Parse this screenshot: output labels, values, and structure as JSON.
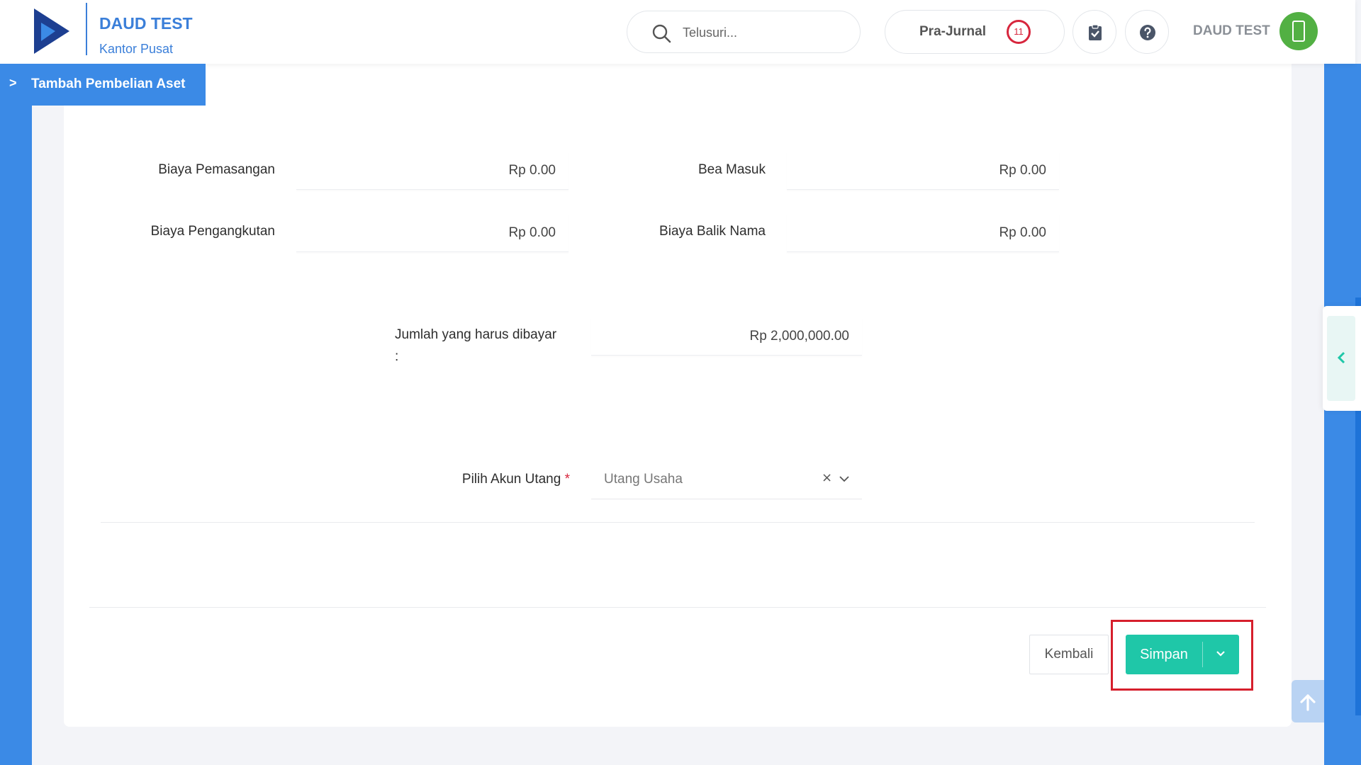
{
  "header": {
    "brand_name": "DAUD TEST",
    "brand_sub": "Kantor Pusat",
    "search_placeholder": "Telusuri...",
    "prajurnal_label": "Pra-Jurnal",
    "prajurnal_count": "11",
    "username": "DAUD TEST"
  },
  "breadcrumb": {
    "chevron": ">",
    "label": "Tambah Pembelian Aset"
  },
  "form": {
    "biaya_pemasangan": {
      "label": "Biaya Pemasangan",
      "value": "Rp 0.00"
    },
    "bea_masuk": {
      "label": "Bea Masuk",
      "value": "Rp 0.00"
    },
    "biaya_pengangkutan": {
      "label": "Biaya Pengangkutan",
      "value": "Rp 0.00"
    },
    "biaya_balik_nama": {
      "label": "Biaya Balik Nama",
      "value": "Rp 0.00"
    },
    "jumlah": {
      "label_line1": "Jumlah yang harus dibayar",
      "label_line2": ":",
      "value": "Rp 2,000,000.00"
    },
    "akun_utang": {
      "label": "Pilih Akun Utang",
      "required_mark": "*",
      "value": "Utang Usaha",
      "clear": "×"
    }
  },
  "footer": {
    "back_label": "Kembali",
    "save_label": "Simpan"
  },
  "colors": {
    "accent_blue": "#3b8ae6",
    "brand_blue": "#3b7fd9",
    "save_green": "#1fc7a8",
    "badge_red": "#d7263d",
    "highlight_red": "#d61f2c",
    "avatar_green": "#52b043"
  },
  "icons": [
    "logo-icon",
    "search-icon",
    "clipboard-check-icon",
    "help-icon",
    "phone-icon",
    "chevron-right-icon",
    "chevron-down-icon",
    "chevron-left-icon",
    "arrow-up-icon",
    "close-icon"
  ]
}
